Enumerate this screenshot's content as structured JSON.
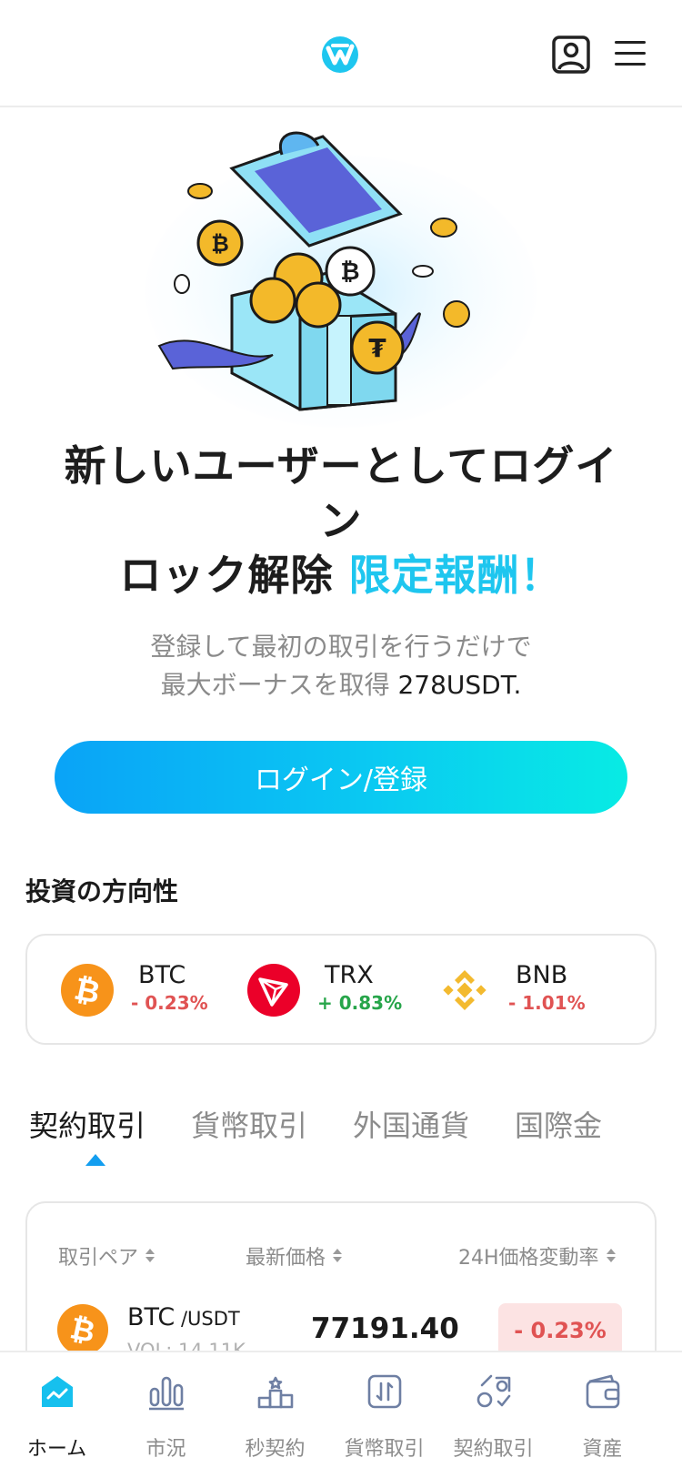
{
  "header": {
    "logo_name": "app-logo",
    "profile_icon": "user-profile-icon",
    "menu_icon": "hamburger-menu-icon"
  },
  "hero": {
    "title_line1": "新しいユーザーとしてログイ",
    "title_line2": "ン",
    "title_line3_prefix": "ロック解除 ",
    "title_line3_accent": "限定報酬！",
    "subtitle_line1": "登録して最初の取引を行うだけで",
    "subtitle_line2_prefix": "最大ボーナスを取得 ",
    "subtitle_amount": "278USDT.",
    "login_button": "ログイン/登録"
  },
  "investment": {
    "title": "投資の方向性",
    "coins": [
      {
        "name": "BTC",
        "change": "- 0.23%",
        "trend": "down",
        "icon": "bitcoin-icon"
      },
      {
        "name": "TRX",
        "change": "+ 0.83%",
        "trend": "up",
        "icon": "tron-icon"
      },
      {
        "name": "BNB",
        "change": "- 1.01%",
        "trend": "down",
        "icon": "bnb-icon"
      }
    ]
  },
  "tabs": [
    {
      "label": "契約取引",
      "active": true
    },
    {
      "label": "貨幣取引",
      "active": false
    },
    {
      "label": "外国通貨",
      "active": false
    },
    {
      "label": "国際金",
      "active": false
    }
  ],
  "market": {
    "headers": {
      "pair": "取引ペア",
      "price": "最新価格",
      "change": "24H価格変動率"
    },
    "rows": [
      {
        "base": "BTC",
        "quote": " /USDT",
        "volume": "VOL: 14.11K",
        "price": "77191.40",
        "change": "- 0.23%",
        "icon": "bitcoin-icon"
      }
    ]
  },
  "bottom_nav": [
    {
      "label": "ホーム",
      "icon": "home-chart-icon",
      "active": true
    },
    {
      "label": "市況",
      "icon": "bar-chart-icon",
      "active": false
    },
    {
      "label": "秒契約",
      "icon": "podium-icon",
      "active": false
    },
    {
      "label": "貨幣取引",
      "icon": "exchange-icon",
      "active": false
    },
    {
      "label": "契約取引",
      "icon": "contract-icon",
      "active": false
    },
    {
      "label": "資産",
      "icon": "wallet-icon",
      "active": false
    }
  ],
  "colors": {
    "accent": "#1ec6ef",
    "primary_blue": "#139ef0",
    "negative": "#e05353",
    "positive": "#27a54a",
    "bitcoin": "#f7931a",
    "tron": "#eb0029",
    "bnb": "#f3ba2f"
  }
}
